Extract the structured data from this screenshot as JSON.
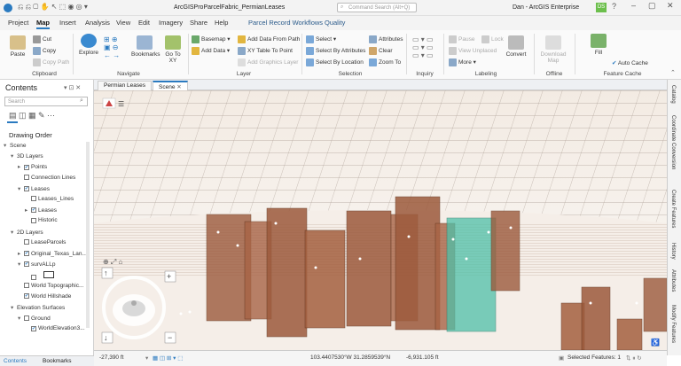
{
  "title": {
    "doc": "ArcGISProParcelFabric_PermianLeases",
    "search_placeholder": "Command Search (Alt+Q)",
    "user": "Dan - ArcGIS Enterprise",
    "user_badge": "DS"
  },
  "menu": [
    "Project",
    "Map",
    "Insert",
    "Analysis",
    "View",
    "Edit",
    "Imagery",
    "Share",
    "Help",
    "Parcel Record Workflows",
    "Quality"
  ],
  "ribbon": {
    "clipboard": {
      "paste": "Paste",
      "cut": "Cut",
      "copy": "Copy",
      "copy_path": "Copy Path",
      "group": "Clipboard"
    },
    "navigate": {
      "explore": "Explore",
      "bookmarks": "Bookmarks",
      "goto": "Go To XY",
      "group": "Navigate"
    },
    "layer": {
      "basemap": "Basemap",
      "add_data": "Add Data",
      "add_from_path": "Add Data From Path",
      "xy_table": "XY Table To Point",
      "add_graphics": "Add Graphics Layer",
      "group": "Layer"
    },
    "selection": {
      "select": "Select",
      "by_attr": "Select By Attributes",
      "by_loc": "Select By Location",
      "attributes": "Attributes",
      "clear": "Clear",
      "zoom_to": "Zoom To",
      "group": "Selection"
    },
    "inquiry": {
      "group": "Inquiry"
    },
    "labeling": {
      "pause": "Pause",
      "lock": "Lock",
      "view_unplaced": "View Unplaced",
      "more": "More",
      "convert": "Convert",
      "group": "Labeling"
    },
    "offline": {
      "download": "Download Map",
      "group": "Offline"
    },
    "cache": {
      "fill": "Fill",
      "auto": "Auto Cache",
      "group": "Feature Cache"
    }
  },
  "contents": {
    "title": "Contents",
    "search_placeholder": "Search",
    "drawing_order": "Drawing Order",
    "items": [
      {
        "label": "Scene",
        "indent": 0,
        "check": false,
        "expand": "▾"
      },
      {
        "label": "3D Layers",
        "indent": 1,
        "check": false,
        "expand": "▾"
      },
      {
        "label": "Points",
        "indent": 2,
        "check": true,
        "expand": "▸"
      },
      {
        "label": "Connection Lines",
        "indent": 2,
        "check": false,
        "expand": ""
      },
      {
        "label": "Leases",
        "indent": 2,
        "check": true,
        "expand": "▾"
      },
      {
        "label": "Leases_Lines",
        "indent": 3,
        "check": false,
        "expand": ""
      },
      {
        "label": "Leases",
        "indent": 3,
        "check": true,
        "expand": "▸"
      },
      {
        "label": "Historic",
        "indent": 3,
        "check": false,
        "expand": ""
      },
      {
        "label": "2D Layers",
        "indent": 1,
        "check": false,
        "expand": "▾"
      },
      {
        "label": "LeaseParcels",
        "indent": 2,
        "check": false,
        "expand": ""
      },
      {
        "label": "Original_Texas_Lan...",
        "indent": 2,
        "check": true,
        "expand": "▸"
      },
      {
        "label": "survALLp",
        "indent": 2,
        "check": true,
        "expand": "▾"
      },
      {
        "label": "",
        "indent": 3,
        "check": false,
        "expand": ""
      },
      {
        "label": "World Topographic...",
        "indent": 2,
        "check": false,
        "expand": ""
      },
      {
        "label": "World Hillshade",
        "indent": 2,
        "check": true,
        "expand": ""
      },
      {
        "label": "Elevation Surfaces",
        "indent": 1,
        "check": false,
        "expand": "▾"
      },
      {
        "label": "Ground",
        "indent": 2,
        "check": false,
        "expand": "▾"
      },
      {
        "label": "WorldElevation3...",
        "indent": 3,
        "check": true,
        "expand": ""
      }
    ]
  },
  "view_tabs": [
    "Permian Leases",
    "Scene"
  ],
  "right_tabs": [
    "Catalog",
    "Coordinate Conversion",
    "Create Features",
    "History",
    "Attributes",
    "Modify Features"
  ],
  "status": {
    "scale": "-27,390 ft",
    "coords": "103.4407530°W 31.2859539°N",
    "elev": "-6,931.105 ft",
    "selected": "Selected Features: 1"
  },
  "bottom_tabs": [
    "Contents",
    "Bookmarks"
  ],
  "colors": {
    "accent": "#2a7ac0",
    "prism": "#9c5a3c",
    "selected": "#4fc0a8",
    "sky": "#f6f2ee"
  }
}
